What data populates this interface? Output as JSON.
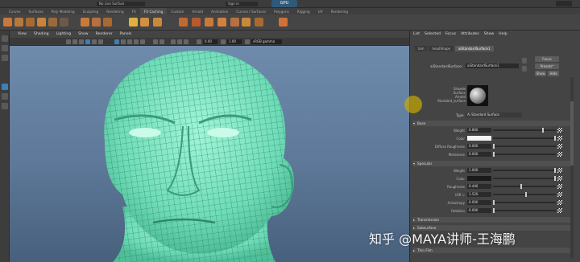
{
  "topbar": {
    "center_field": "No Live Surface",
    "status_label": "Sign in",
    "badge_label": "GPU"
  },
  "shelf_tabs": [
    "Curves",
    "Surfaces",
    "Poly Modeling",
    "Sculpting",
    "Rendering",
    "FX",
    "FX Caching",
    "Custom",
    "Arnold",
    "Animation",
    "Curves / Surfaces",
    "Polygons",
    "Rigging",
    "UV",
    "Rendering"
  ],
  "viewport": {
    "menu": [
      "View",
      "Shading",
      "Lighting",
      "Show",
      "Renderer",
      "Panels"
    ],
    "field_a": "0.00",
    "field_b": "1.00",
    "colorspace": "sRGB gamma"
  },
  "ae": {
    "menu": [
      "List",
      "Selected",
      "Focus",
      "Attributes",
      "Show",
      "Help"
    ],
    "tabs": [
      "lam",
      "headShape",
      "aiStandardSurface1"
    ],
    "node_label": "aiStandardSurface:",
    "node_value": "aiStandardSurface1",
    "focus_btn": "Focus",
    "presets_btn": "Presets*",
    "show_btn": "Show",
    "hide_btn": "Hide",
    "sample_labels": [
      "Shaede",
      "Surface",
      "Arnold",
      "Standard_surface"
    ],
    "type_label": "Type",
    "type_value": "Ai Standard Surface",
    "sections": {
      "base": "Base",
      "specular": "Specular",
      "transmission": "Transmission",
      "subsurface": "Subsurface",
      "thin_film": "Thin Film"
    },
    "base_attrs": [
      {
        "label": "Weight",
        "value": "0.800"
      },
      {
        "label": "Color",
        "value": ""
      },
      {
        "label": "Diffuse Roughness",
        "value": "0.000"
      },
      {
        "label": "Metalness",
        "value": "0.000"
      }
    ],
    "spec_attrs": [
      {
        "label": "Weight",
        "value": "1.000"
      },
      {
        "label": "Color",
        "value": ""
      },
      {
        "label": "Roughness",
        "value": "0.446"
      },
      {
        "label": "IOR ≈",
        "value": "1.520"
      },
      {
        "label": "Anisotropy",
        "value": "0.000"
      },
      {
        "label": "Rotation",
        "value": "0.000"
      }
    ],
    "levels": {
      "base_weight": 0.8,
      "diffuse_roughness": 0.0,
      "metalness": 0.0,
      "spec_weight": 1.0,
      "spec_roughness": 0.446,
      "ior": 0.52,
      "anisotropy": 0.0,
      "rotation": 0.0
    },
    "colors": {
      "base_color": "#f4f4f4",
      "spec_color": "#1a1a1a"
    }
  },
  "watermark": "知乎 @MAYA讲师-王海鹏",
  "colors": {
    "wireframe": "#7fe8c6",
    "viewport_top": "#6f8bab",
    "selection_blue": "#3d7fb8"
  }
}
